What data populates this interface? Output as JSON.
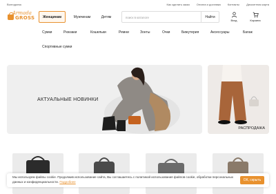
{
  "topbar": {
    "city": "Волгодонск",
    "links": [
      "Как сделать заказ",
      "Оплата и доставка",
      "Контакты",
      "Дисконтная карта"
    ]
  },
  "logo": {
    "script": "Armada",
    "word": "GROSS"
  },
  "gender_tabs": {
    "women": "Женщинам",
    "men": "Мужчинам",
    "kids": "Детям",
    "active": "women"
  },
  "search": {
    "placeholder": "поиск в каталоге",
    "button": "Найти"
  },
  "header_icons": {
    "login": "Вход",
    "cart": "Корзина"
  },
  "categories": [
    "Сумки",
    "Рюкзаки",
    "Кошельки",
    "Ремни",
    "Зонты",
    "Очки",
    "Бижутерия",
    "Аксессуары",
    "Багаж",
    "Спортивные сумки"
  ],
  "banners": {
    "main_title": "АКТУАЛЬНЫЕ НОВИНКИ",
    "side_label": "РАСПРОДАЖА"
  },
  "cookie": {
    "text": "Мы используем файлы cookie. Продолжив использование сайта, Вы соглашаетесь с политикой использования файлов cookie, обработки персональных данных и конфиденциальности.",
    "link": "Подробнее",
    "button": "ОК, скрыть"
  },
  "colors": {
    "accent": "#e8912e"
  }
}
